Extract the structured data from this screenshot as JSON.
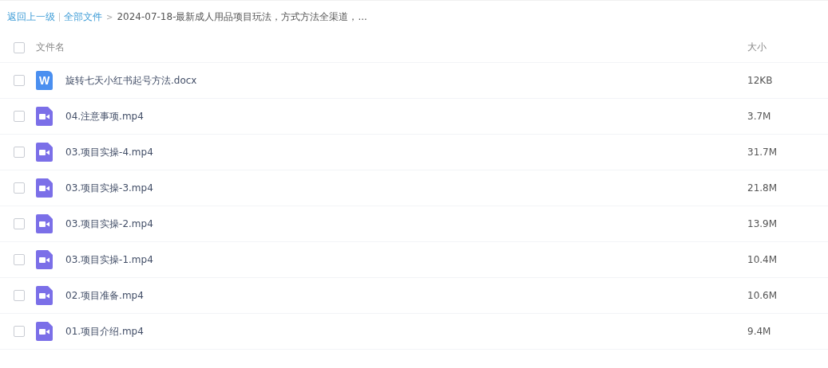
{
  "breadcrumb": {
    "back": "返回上一级",
    "root": "全部文件",
    "separator": ">",
    "current": "2024-07-18-最新成人用品项目玩法，方式方法全渠道，..."
  },
  "table": {
    "header": {
      "checked": false,
      "name": "文件名",
      "size": "大小"
    },
    "rows": [
      {
        "kind": "doc",
        "name": "旋转七天小红书起号方法.docx",
        "size": "12KB",
        "checked": false,
        "icon_letter": "W"
      },
      {
        "kind": "video",
        "name": "04.注意事项.mp4",
        "size": "3.7M",
        "checked": false
      },
      {
        "kind": "video",
        "name": "03.项目实操-4.mp4",
        "size": "31.7M",
        "checked": false
      },
      {
        "kind": "video",
        "name": "03.项目实操-3.mp4",
        "size": "21.8M",
        "checked": false
      },
      {
        "kind": "video",
        "name": "03.项目实操-2.mp4",
        "size": "13.9M",
        "checked": false
      },
      {
        "kind": "video",
        "name": "03.项目实操-1.mp4",
        "size": "10.4M",
        "checked": false
      },
      {
        "kind": "video",
        "name": "02.项目准备.mp4",
        "size": "10.6M",
        "checked": false
      },
      {
        "kind": "video",
        "name": "01.项目介绍.mp4",
        "size": "9.4M",
        "checked": false
      }
    ]
  }
}
